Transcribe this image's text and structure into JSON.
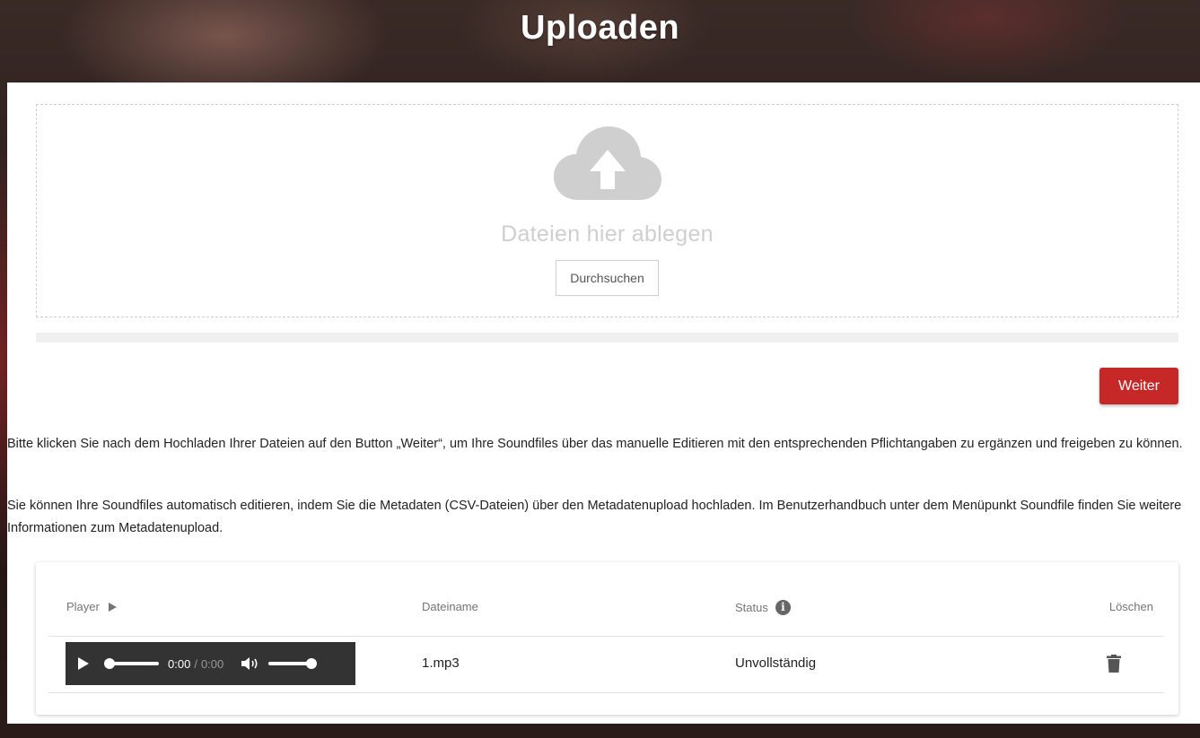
{
  "page": {
    "title": "Uploaden"
  },
  "dropzone": {
    "icon": "cloud-upload-icon",
    "text": "Dateien hier ablegen",
    "browse_label": "Durchsuchen"
  },
  "upload_progress": {
    "percent": 0
  },
  "actions": {
    "next_label": "Weiter"
  },
  "info": {
    "paragraph1": "Bitte klicken Sie nach dem Hochladen Ihrer Dateien auf den Button „Weiter“, um Ihre Soundfiles über das manuelle Editieren mit den entsprechenden Pflichtangaben zu ergänzen und freigeben zu können.",
    "paragraph2": "Sie können Ihre Soundfiles automatisch editieren, indem Sie die Metadaten (CSV-Dateien) über den Metadatenupload hochladen. Im Benutzerhandbuch unter dem Menüpunkt Soundfile finden Sie weitere Informationen zum Metadatenupload."
  },
  "table": {
    "columns": {
      "player": "Player",
      "filename": "Dateiname",
      "status": "Status",
      "delete": "Löschen"
    },
    "rows": [
      {
        "player": {
          "current_time": "0:00",
          "separator": "/",
          "total_time": "0:00"
        },
        "filename": "1.mp3",
        "status": "Unvollständig"
      }
    ]
  },
  "colors": {
    "accent": "#c62828",
    "player_bg": "#333333",
    "dropzone_text": "#cfcfcf"
  }
}
